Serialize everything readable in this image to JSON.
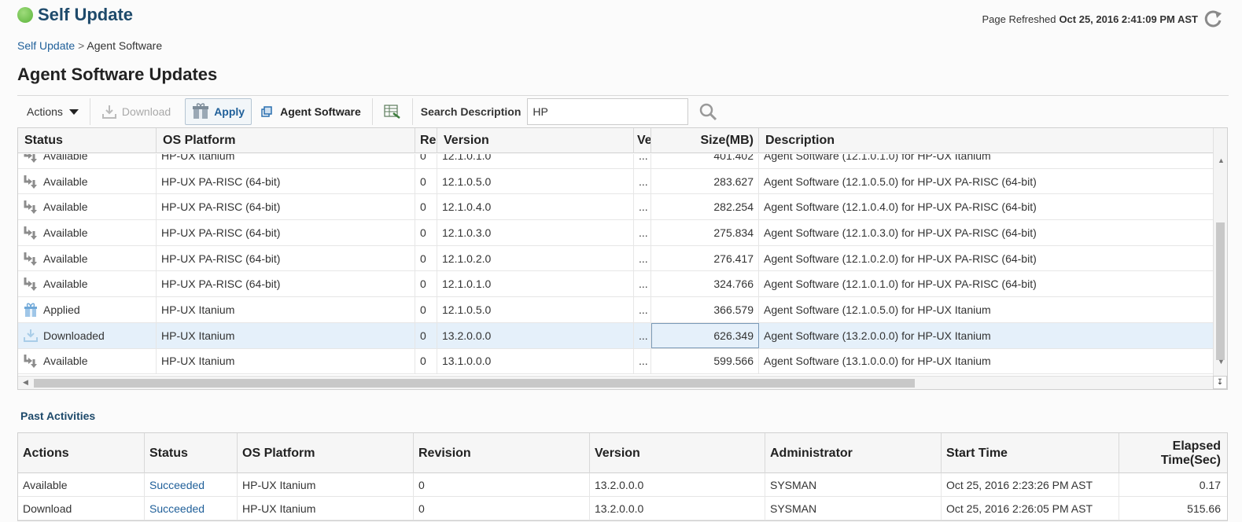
{
  "app": {
    "title": "Self Update"
  },
  "refresh": {
    "label": "Page Refreshed",
    "value": "Oct 25, 2016 2:41:09 PM AST"
  },
  "breadcrumb": {
    "parent": "Self Update",
    "separator": ">",
    "current": "Agent Software"
  },
  "page": {
    "title": "Agent Software Updates"
  },
  "toolbar": {
    "actions": "Actions",
    "download": "Download",
    "apply": "Apply",
    "agent_software": "Agent Software",
    "search_label": "Search Description",
    "search_value": "HP"
  },
  "grid": {
    "columns": [
      "Status",
      "OS Platform",
      "Re",
      "Version",
      "Ve",
      "Size(MB)",
      "Description"
    ],
    "rows": [
      {
        "status": "Available",
        "icon": "available-icon",
        "platform": "HP-UX Itanium",
        "rev": "0",
        "version": "12.1.0.1.0",
        "ve": "...",
        "size": "401.402",
        "description": "Agent Software (12.1.0.1.0) for HP-UX Itanium"
      },
      {
        "status": "Available",
        "icon": "available-icon",
        "platform": "HP-UX PA-RISC (64-bit)",
        "rev": "0",
        "version": "12.1.0.5.0",
        "ve": "...",
        "size": "283.627",
        "description": "Agent Software (12.1.0.5.0) for HP-UX PA-RISC (64-bit)"
      },
      {
        "status": "Available",
        "icon": "available-icon",
        "platform": "HP-UX PA-RISC (64-bit)",
        "rev": "0",
        "version": "12.1.0.4.0",
        "ve": "...",
        "size": "282.254",
        "description": "Agent Software (12.1.0.4.0) for HP-UX PA-RISC (64-bit)"
      },
      {
        "status": "Available",
        "icon": "available-icon",
        "platform": "HP-UX PA-RISC (64-bit)",
        "rev": "0",
        "version": "12.1.0.3.0",
        "ve": "...",
        "size": "275.834",
        "description": "Agent Software (12.1.0.3.0) for HP-UX PA-RISC (64-bit)"
      },
      {
        "status": "Available",
        "icon": "available-icon",
        "platform": "HP-UX PA-RISC (64-bit)",
        "rev": "0",
        "version": "12.1.0.2.0",
        "ve": "...",
        "size": "276.417",
        "description": "Agent Software (12.1.0.2.0) for HP-UX PA-RISC (64-bit)"
      },
      {
        "status": "Available",
        "icon": "available-icon",
        "platform": "HP-UX PA-RISC (64-bit)",
        "rev": "0",
        "version": "12.1.0.1.0",
        "ve": "...",
        "size": "324.766",
        "description": "Agent Software (12.1.0.1.0) for HP-UX PA-RISC (64-bit)"
      },
      {
        "status": "Applied",
        "icon": "applied-icon",
        "platform": "HP-UX Itanium",
        "rev": "0",
        "version": "12.1.0.5.0",
        "ve": "...",
        "size": "366.579",
        "description": "Agent Software (12.1.0.5.0) for HP-UX Itanium"
      },
      {
        "status": "Downloaded",
        "icon": "downloaded-icon",
        "platform": "HP-UX Itanium",
        "rev": "0",
        "version": "13.2.0.0.0",
        "ve": "...",
        "size": "626.349",
        "description": "Agent Software (13.2.0.0.0) for HP-UX Itanium",
        "selected": true
      },
      {
        "status": "Available",
        "icon": "available-icon",
        "platform": "HP-UX Itanium",
        "rev": "0",
        "version": "13.1.0.0.0",
        "ve": "...",
        "size": "599.566",
        "description": "Agent Software (13.1.0.0.0) for HP-UX Itanium"
      }
    ]
  },
  "past": {
    "title": "Past Activities",
    "columns": [
      "Actions",
      "Status",
      "OS Platform",
      "Revision",
      "Version",
      "Administrator",
      "Start Time",
      "Elapsed Time(Sec)"
    ],
    "rows": [
      {
        "action": "Available",
        "status": "Succeeded",
        "platform": "HP-UX Itanium",
        "revision": "0",
        "version": "13.2.0.0.0",
        "admin": "SYSMAN",
        "start": "Oct 25, 2016 2:23:26 PM AST",
        "elapsed": "0.17"
      },
      {
        "action": "Download",
        "status": "Succeeded",
        "platform": "HP-UX Itanium",
        "revision": "0",
        "version": "13.2.0.0.0",
        "admin": "SYSMAN",
        "start": "Oct 25, 2016 2:26:05 PM AST",
        "elapsed": "515.66"
      }
    ]
  },
  "colors": {
    "accent": "#1f5f99",
    "title": "#1e4a6b",
    "selected_row": "#e5f0fa",
    "status_ok": "#5bb33a"
  }
}
